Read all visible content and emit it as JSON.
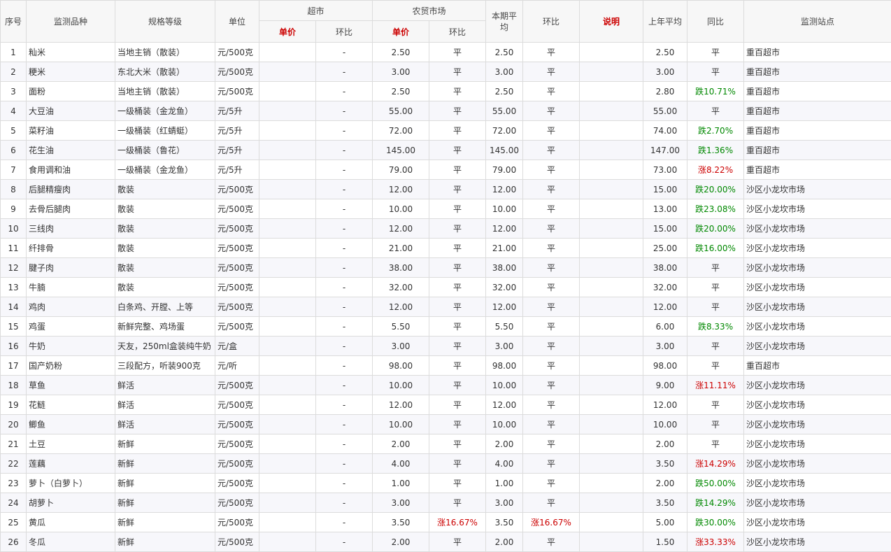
{
  "headers": {
    "seq": "序号",
    "item": "监测品种",
    "spec": "规格等级",
    "unit": "单位",
    "supermarket": "超市",
    "farm_market": "农贸市场",
    "unit_price": "单价",
    "mom": "环比",
    "period_avg": "本期平均",
    "period_mom": "环比",
    "note": "说明",
    "last_year_avg": "上年平均",
    "yoy": "同比",
    "station": "监测站点"
  },
  "rows": [
    {
      "no": "1",
      "item": "籼米",
      "spec": "当地主销（散装）",
      "unit": "元/500克",
      "s_price": "",
      "s_mom": "-",
      "f_price": "2.50",
      "f_mom": "平",
      "avg": "2.50",
      "avg_mom": "平",
      "note": "",
      "last": "2.50",
      "yoy": "平",
      "station": "重百超市"
    },
    {
      "no": "2",
      "item": "粳米",
      "spec": "东北大米（散装）",
      "unit": "元/500克",
      "s_price": "",
      "s_mom": "-",
      "f_price": "3.00",
      "f_mom": "平",
      "avg": "3.00",
      "avg_mom": "平",
      "note": "",
      "last": "3.00",
      "yoy": "平",
      "station": "重百超市"
    },
    {
      "no": "3",
      "item": "面粉",
      "spec": "当地主销（散装）",
      "unit": "元/500克",
      "s_price": "",
      "s_mom": "-",
      "f_price": "2.50",
      "f_mom": "平",
      "avg": "2.50",
      "avg_mom": "平",
      "note": "",
      "last": "2.80",
      "yoy": "跌10.71%",
      "station": "重百超市"
    },
    {
      "no": "4",
      "item": "大豆油",
      "spec": "一级桶装（金龙鱼）",
      "unit": "元/5升",
      "s_price": "",
      "s_mom": "-",
      "f_price": "55.00",
      "f_mom": "平",
      "avg": "55.00",
      "avg_mom": "平",
      "note": "",
      "last": "55.00",
      "yoy": "平",
      "station": "重百超市"
    },
    {
      "no": "5",
      "item": "菜籽油",
      "spec": "一级桶装（红蜻蜓）",
      "unit": "元/5升",
      "s_price": "",
      "s_mom": "-",
      "f_price": "72.00",
      "f_mom": "平",
      "avg": "72.00",
      "avg_mom": "平",
      "note": "",
      "last": "74.00",
      "yoy": "跌2.70%",
      "station": "重百超市"
    },
    {
      "no": "6",
      "item": "花生油",
      "spec": "一级桶装（鲁花）",
      "unit": "元/5升",
      "s_price": "",
      "s_mom": "-",
      "f_price": "145.00",
      "f_mom": "平",
      "avg": "145.00",
      "avg_mom": "平",
      "note": "",
      "last": "147.00",
      "yoy": "跌1.36%",
      "station": "重百超市"
    },
    {
      "no": "7",
      "item": "食用调和油",
      "spec": "一级桶装（金龙鱼）",
      "unit": "元/5升",
      "s_price": "",
      "s_mom": "-",
      "f_price": "79.00",
      "f_mom": "平",
      "avg": "79.00",
      "avg_mom": "平",
      "note": "",
      "last": "73.00",
      "yoy": "涨8.22%",
      "station": "重百超市"
    },
    {
      "no": "8",
      "item": "后腿精瘦肉",
      "spec": "散装",
      "unit": "元/500克",
      "s_price": "",
      "s_mom": "-",
      "f_price": "12.00",
      "f_mom": "平",
      "avg": "12.00",
      "avg_mom": "平",
      "note": "",
      "last": "15.00",
      "yoy": "跌20.00%",
      "station": "沙区小龙坎市场"
    },
    {
      "no": "9",
      "item": "去骨后腿肉",
      "spec": "散装",
      "unit": "元/500克",
      "s_price": "",
      "s_mom": "-",
      "f_price": "10.00",
      "f_mom": "平",
      "avg": "10.00",
      "avg_mom": "平",
      "note": "",
      "last": "13.00",
      "yoy": "跌23.08%",
      "station": "沙区小龙坎市场"
    },
    {
      "no": "10",
      "item": "三线肉",
      "spec": "散装",
      "unit": "元/500克",
      "s_price": "",
      "s_mom": "-",
      "f_price": "12.00",
      "f_mom": "平",
      "avg": "12.00",
      "avg_mom": "平",
      "note": "",
      "last": "15.00",
      "yoy": "跌20.00%",
      "station": "沙区小龙坎市场"
    },
    {
      "no": "11",
      "item": "纤排骨",
      "spec": "散装",
      "unit": "元/500克",
      "s_price": "",
      "s_mom": "-",
      "f_price": "21.00",
      "f_mom": "平",
      "avg": "21.00",
      "avg_mom": "平",
      "note": "",
      "last": "25.00",
      "yoy": "跌16.00%",
      "station": "沙区小龙坎市场"
    },
    {
      "no": "12",
      "item": "腱子肉",
      "spec": "散装",
      "unit": "元/500克",
      "s_price": "",
      "s_mom": "-",
      "f_price": "38.00",
      "f_mom": "平",
      "avg": "38.00",
      "avg_mom": "平",
      "note": "",
      "last": "38.00",
      "yoy": "平",
      "station": "沙区小龙坎市场"
    },
    {
      "no": "13",
      "item": "牛腩",
      "spec": "散装",
      "unit": "元/500克",
      "s_price": "",
      "s_mom": "-",
      "f_price": "32.00",
      "f_mom": "平",
      "avg": "32.00",
      "avg_mom": "平",
      "note": "",
      "last": "32.00",
      "yoy": "平",
      "station": "沙区小龙坎市场"
    },
    {
      "no": "14",
      "item": "鸡肉",
      "spec": "白条鸡、开膛、上等",
      "unit": "元/500克",
      "s_price": "",
      "s_mom": "-",
      "f_price": "12.00",
      "f_mom": "平",
      "avg": "12.00",
      "avg_mom": "平",
      "note": "",
      "last": "12.00",
      "yoy": "平",
      "station": "沙区小龙坎市场"
    },
    {
      "no": "15",
      "item": "鸡蛋",
      "spec": "新鲜完整、鸡场蛋",
      "unit": "元/500克",
      "s_price": "",
      "s_mom": "-",
      "f_price": "5.50",
      "f_mom": "平",
      "avg": "5.50",
      "avg_mom": "平",
      "note": "",
      "last": "6.00",
      "yoy": "跌8.33%",
      "station": "沙区小龙坎市场"
    },
    {
      "no": "16",
      "item": "牛奶",
      "spec": "天友，250ml盒装纯牛奶",
      "unit": "元/盒",
      "s_price": "",
      "s_mom": "-",
      "f_price": "3.00",
      "f_mom": "平",
      "avg": "3.00",
      "avg_mom": "平",
      "note": "",
      "last": "3.00",
      "yoy": "平",
      "station": "沙区小龙坎市场"
    },
    {
      "no": "17",
      "item": "国产奶粉",
      "spec": "三段配方，听装900克",
      "unit": "元/听",
      "s_price": "",
      "s_mom": "-",
      "f_price": "98.00",
      "f_mom": "平",
      "avg": "98.00",
      "avg_mom": "平",
      "note": "",
      "last": "98.00",
      "yoy": "平",
      "station": "重百超市"
    },
    {
      "no": "18",
      "item": "草鱼",
      "spec": "鲜活",
      "unit": "元/500克",
      "s_price": "",
      "s_mom": "-",
      "f_price": "10.00",
      "f_mom": "平",
      "avg": "10.00",
      "avg_mom": "平",
      "note": "",
      "last": "9.00",
      "yoy": "涨11.11%",
      "station": "沙区小龙坎市场"
    },
    {
      "no": "19",
      "item": "花鲢",
      "spec": "鲜活",
      "unit": "元/500克",
      "s_price": "",
      "s_mom": "-",
      "f_price": "12.00",
      "f_mom": "平",
      "avg": "12.00",
      "avg_mom": "平",
      "note": "",
      "last": "12.00",
      "yoy": "平",
      "station": "沙区小龙坎市场"
    },
    {
      "no": "20",
      "item": "鲫鱼",
      "spec": "鲜活",
      "unit": "元/500克",
      "s_price": "",
      "s_mom": "-",
      "f_price": "10.00",
      "f_mom": "平",
      "avg": "10.00",
      "avg_mom": "平",
      "note": "",
      "last": "10.00",
      "yoy": "平",
      "station": "沙区小龙坎市场"
    },
    {
      "no": "21",
      "item": "土豆",
      "spec": "新鲜",
      "unit": "元/500克",
      "s_price": "",
      "s_mom": "-",
      "f_price": "2.00",
      "f_mom": "平",
      "avg": "2.00",
      "avg_mom": "平",
      "note": "",
      "last": "2.00",
      "yoy": "平",
      "station": "沙区小龙坎市场"
    },
    {
      "no": "22",
      "item": "莲藕",
      "spec": "新鲜",
      "unit": "元/500克",
      "s_price": "",
      "s_mom": "-",
      "f_price": "4.00",
      "f_mom": "平",
      "avg": "4.00",
      "avg_mom": "平",
      "note": "",
      "last": "3.50",
      "yoy": "涨14.29%",
      "station": "沙区小龙坎市场"
    },
    {
      "no": "23",
      "item": "萝卜（白萝卜）",
      "spec": "新鲜",
      "unit": "元/500克",
      "s_price": "",
      "s_mom": "-",
      "f_price": "1.00",
      "f_mom": "平",
      "avg": "1.00",
      "avg_mom": "平",
      "note": "",
      "last": "2.00",
      "yoy": "跌50.00%",
      "station": "沙区小龙坎市场"
    },
    {
      "no": "24",
      "item": "胡萝卜",
      "spec": "新鲜",
      "unit": "元/500克",
      "s_price": "",
      "s_mom": "-",
      "f_price": "3.00",
      "f_mom": "平",
      "avg": "3.00",
      "avg_mom": "平",
      "note": "",
      "last": "3.50",
      "yoy": "跌14.29%",
      "station": "沙区小龙坎市场"
    },
    {
      "no": "25",
      "item": "黄瓜",
      "spec": "新鲜",
      "unit": "元/500克",
      "s_price": "",
      "s_mom": "-",
      "f_price": "3.50",
      "f_mom": "涨16.67%",
      "avg": "3.50",
      "avg_mom": "涨16.67%",
      "note": "",
      "last": "5.00",
      "yoy": "跌30.00%",
      "station": "沙区小龙坎市场"
    },
    {
      "no": "26",
      "item": "冬瓜",
      "spec": "新鲜",
      "unit": "元/500克",
      "s_price": "",
      "s_mom": "-",
      "f_price": "2.00",
      "f_mom": "平",
      "avg": "2.00",
      "avg_mom": "平",
      "note": "",
      "last": "1.50",
      "yoy": "涨33.33%",
      "station": "沙区小龙坎市场"
    }
  ],
  "colors": {
    "up": "#cc0000",
    "down": "#008800",
    "header_bg": "#f7f7f7",
    "stripe_bg": "#f7f7fb"
  }
}
